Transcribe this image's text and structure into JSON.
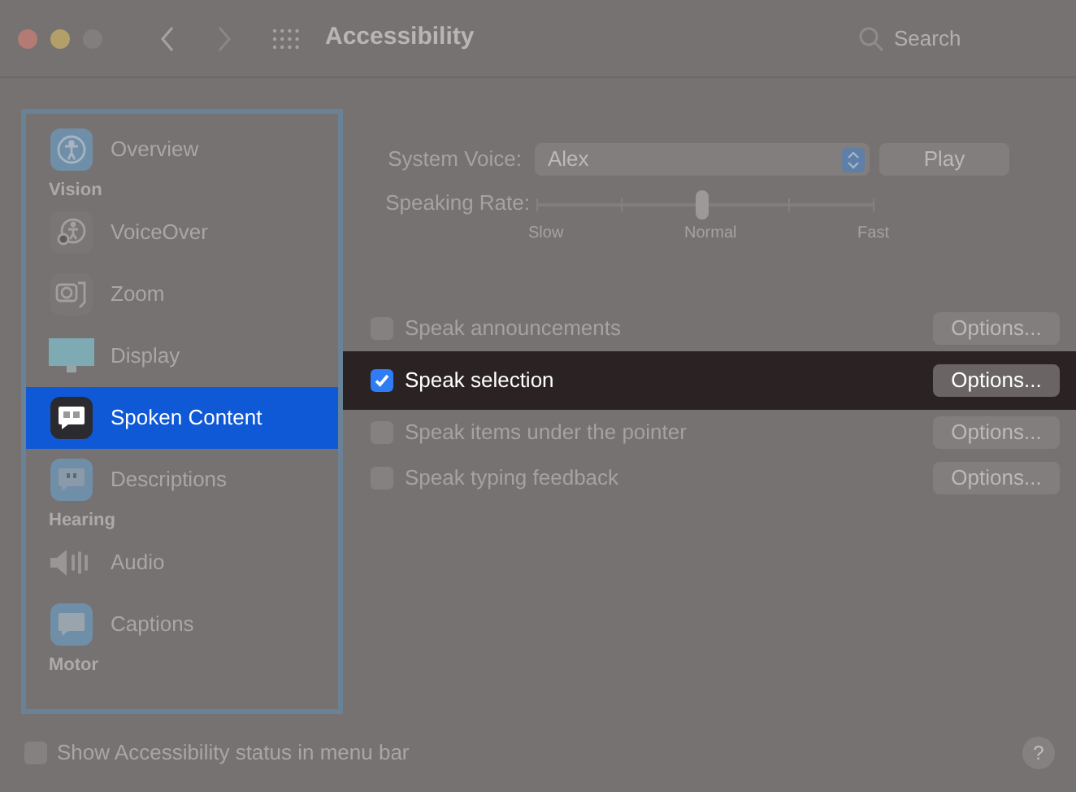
{
  "window": {
    "title": "Accessibility",
    "search": {
      "placeholder": "Search"
    }
  },
  "sidebar": {
    "items": [
      {
        "kind": "item",
        "label": "Overview",
        "selected": false
      },
      {
        "kind": "heading",
        "label": "Vision"
      },
      {
        "kind": "item",
        "label": "VoiceOver",
        "selected": false
      },
      {
        "kind": "item",
        "label": "Zoom",
        "selected": false
      },
      {
        "kind": "item",
        "label": "Display",
        "selected": false
      },
      {
        "kind": "item",
        "label": "Spoken Content",
        "selected": true
      },
      {
        "kind": "item",
        "label": "Descriptions",
        "selected": false
      },
      {
        "kind": "heading",
        "label": "Hearing"
      },
      {
        "kind": "item",
        "label": "Audio",
        "selected": false
      },
      {
        "kind": "item",
        "label": "Captions",
        "selected": false
      },
      {
        "kind": "heading",
        "label": "Motor"
      }
    ]
  },
  "system_voice": {
    "label": "System Voice:",
    "value": "Alex",
    "button": "Play"
  },
  "speaking_rate": {
    "label": "Speaking Rate:",
    "level": 0.49,
    "ticks": [
      "Slow",
      "Normal",
      "Fast"
    ]
  },
  "options": [
    {
      "label": "Speak announcements",
      "checked": false,
      "highlighted": false,
      "button": "Options..."
    },
    {
      "label": "Speak selection",
      "checked": true,
      "highlighted": true,
      "button": "Options..."
    },
    {
      "label": "Speak items under the pointer",
      "checked": false,
      "highlighted": false,
      "button": "Options..."
    },
    {
      "label": "Speak typing feedback",
      "checked": false,
      "highlighted": false,
      "button": "Options..."
    }
  ],
  "footer": {
    "label": "Show Accessibility status in menu bar",
    "checked": false,
    "help": "?"
  }
}
